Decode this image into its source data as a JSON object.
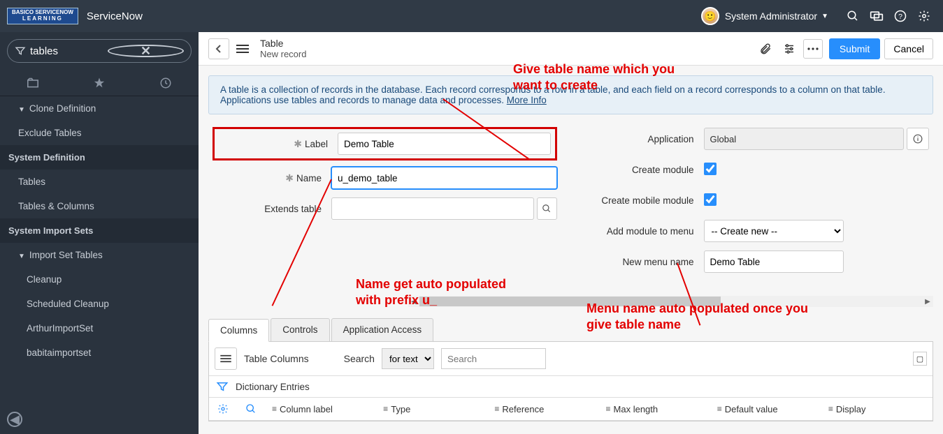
{
  "banner": {
    "logo_line1": "BASICO SERVICENOW",
    "logo_line2": "LEARNING",
    "brand": "ServiceNow",
    "user": "System Administrator"
  },
  "nav": {
    "filter_value": "tables",
    "items": [
      {
        "type": "item",
        "label": "Clone Definition",
        "caret": true,
        "sub": 0
      },
      {
        "type": "item",
        "label": "Exclude Tables",
        "sub": 1
      },
      {
        "type": "section",
        "label": "System Definition"
      },
      {
        "type": "item",
        "label": "Tables",
        "sub": 1
      },
      {
        "type": "item",
        "label": "Tables & Columns",
        "sub": 1
      },
      {
        "type": "section",
        "label": "System Import Sets"
      },
      {
        "type": "item",
        "label": "Import Set Tables",
        "caret": true,
        "sub": 1
      },
      {
        "type": "item",
        "label": "Cleanup",
        "sub": 2
      },
      {
        "type": "item",
        "label": "Scheduled Cleanup",
        "sub": 2
      },
      {
        "type": "item",
        "label": "ArthurImportSet",
        "sub": 2
      },
      {
        "type": "item",
        "label": "babitaimportset",
        "sub": 2
      }
    ]
  },
  "header": {
    "title": "Table",
    "subtitle": "New record",
    "submit": "Submit",
    "cancel": "Cancel"
  },
  "info_text": "A table is a collection of records in the database. Each record corresponds to a row in a table, and each field on a record corresponds to a column on that table. Applications use tables and records to manage data and processes. ",
  "info_link": "More Info",
  "form": {
    "label_field": "Label",
    "label_value": "Demo Table",
    "name_field": "Name",
    "name_value": "u_demo_table",
    "extends_field": "Extends table",
    "extends_value": "",
    "application_field": "Application",
    "application_value": "Global",
    "create_module_field": "Create module",
    "create_mobile_field": "Create mobile module",
    "add_module_field": "Add module to menu",
    "add_module_value": "-- Create new --",
    "new_menu_field": "New menu name",
    "new_menu_value": "Demo Table"
  },
  "tabs": [
    "Columns",
    "Controls",
    "Application Access"
  ],
  "list": {
    "title": "Table Columns",
    "search_label": "Search",
    "search_mode": "for text",
    "search_placeholder": "Search",
    "filter_label": "Dictionary Entries",
    "columns": [
      "Column label",
      "Type",
      "Reference",
      "Max length",
      "Default value",
      "Display"
    ]
  },
  "annotations": {
    "a1": "Give table name which you want to create",
    "a2": "Name get auto populated with prefix u_",
    "a3": "Menu name auto populated once you give table name"
  }
}
